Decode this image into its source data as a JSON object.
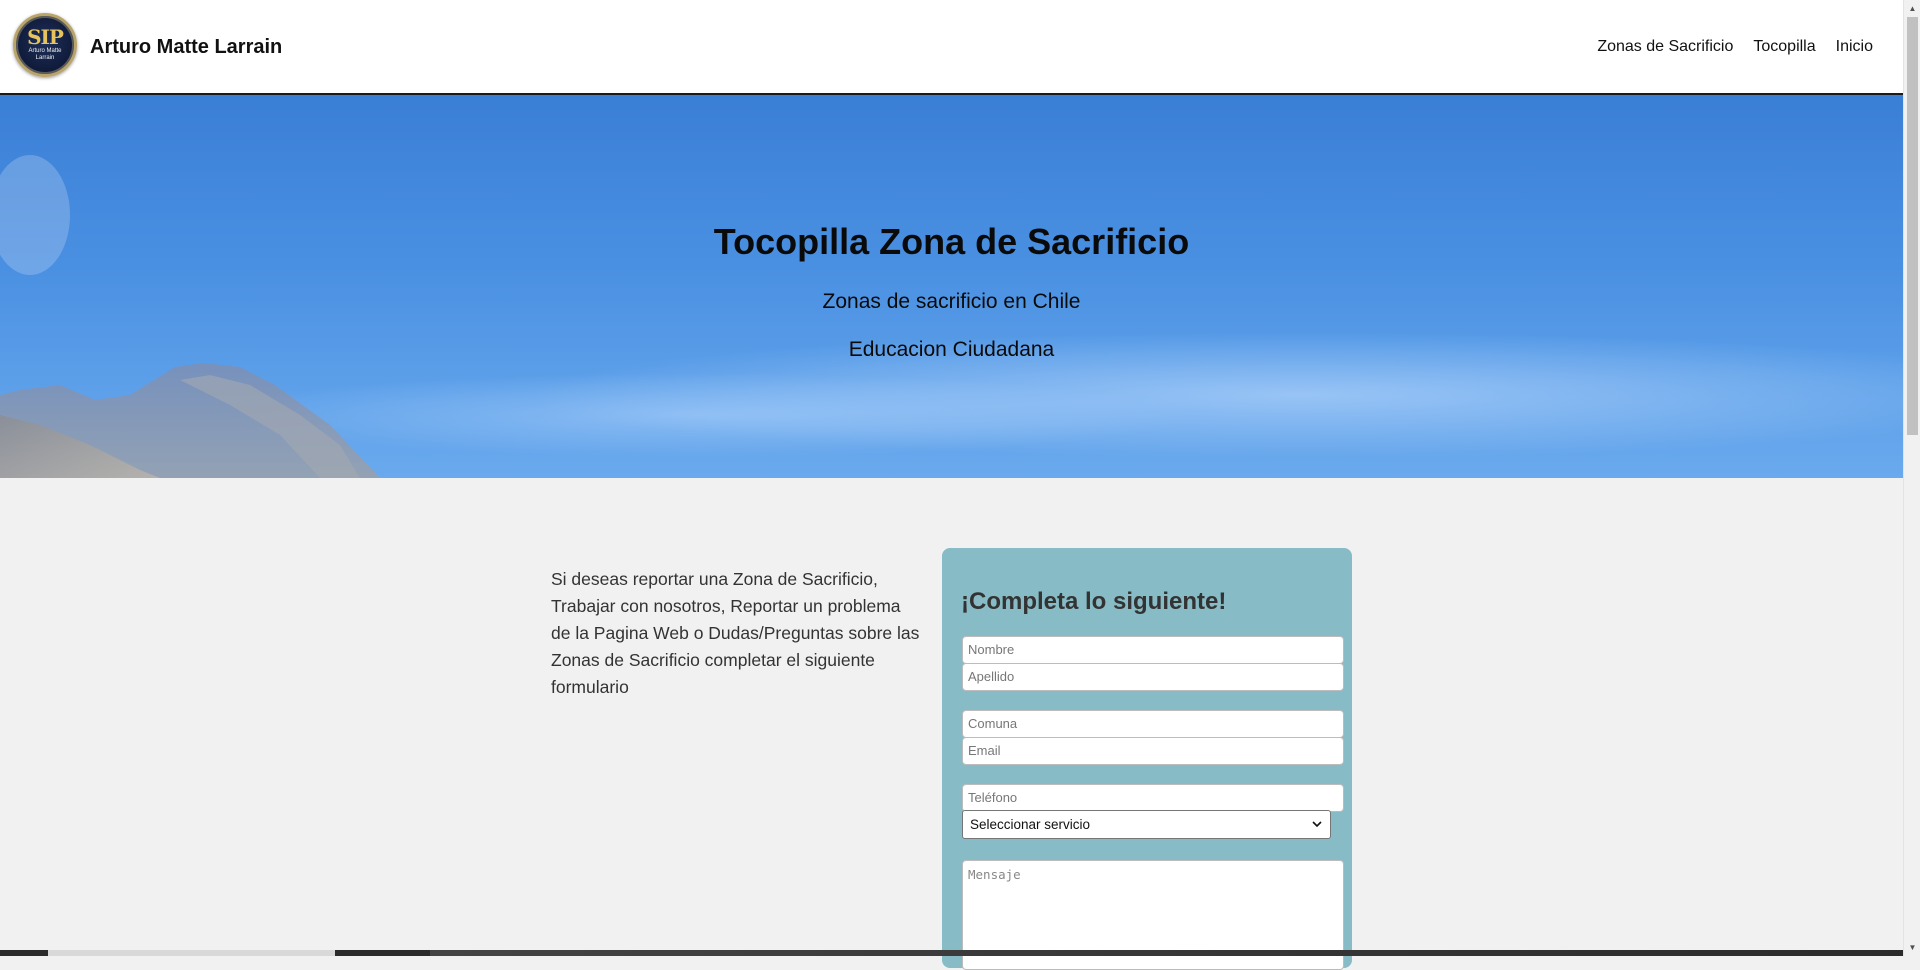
{
  "header": {
    "logo": {
      "text": "SIP",
      "subtext": "Arturo Matte Larrain"
    },
    "brand": "Arturo Matte Larrain",
    "nav": [
      {
        "label": "Zonas de Sacrificio"
      },
      {
        "label": "Tocopilla"
      },
      {
        "label": "Inicio"
      }
    ]
  },
  "hero": {
    "title": "Tocopilla Zona de Sacrificio",
    "subtitle1": "Zonas de sacrificio en Chile",
    "subtitle2": "Educacion Ciudadana"
  },
  "intro": {
    "text": "Si deseas reportar una Zona de Sacrificio, Trabajar con nosotros, Reportar un problema de la Pagina Web o Dudas/Preguntas sobre las Zonas de Sacrificio completar el siguiente formulario"
  },
  "form": {
    "title": "¡Completa lo siguiente!",
    "nombre_placeholder": "Nombre",
    "apellido_placeholder": "Apellido",
    "comuna_placeholder": "Comuna",
    "email_placeholder": "Email",
    "telefono_placeholder": "Teléfono",
    "servicio_selected": "Seleccionar servicio",
    "mensaje_placeholder": "Mensaje"
  },
  "colors": {
    "form_background": "#87bcc6",
    "hero_sky": "#4a90e2",
    "page_background": "#f1f1f1"
  }
}
